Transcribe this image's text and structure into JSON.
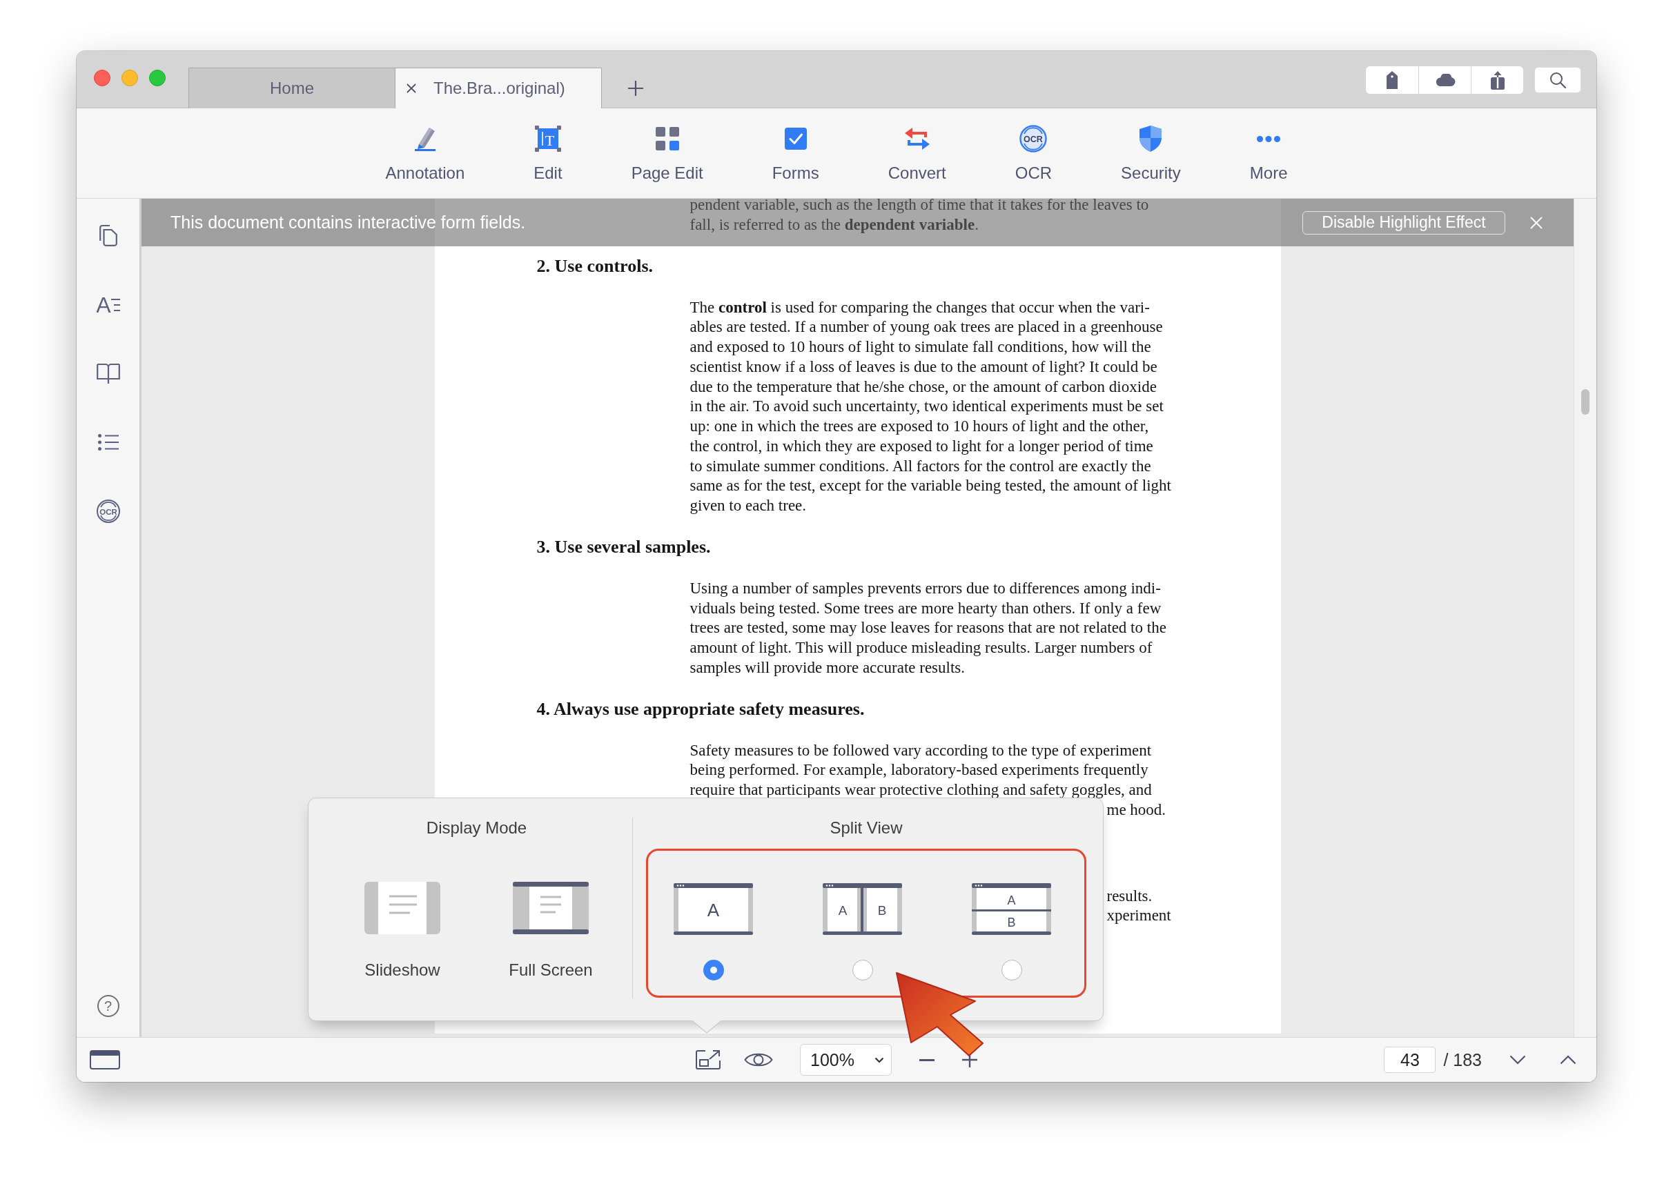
{
  "tabs": [
    {
      "label": "Home",
      "selected": false
    },
    {
      "label": "The.Bra...original)",
      "selected": true
    }
  ],
  "toolbar": {
    "items": [
      {
        "label": "Annotation",
        "kind": "pen"
      },
      {
        "label": "Edit",
        "kind": "text-box",
        "glyph": "T"
      },
      {
        "label": "Page Edit",
        "kind": "grid"
      },
      {
        "label": "Forms",
        "kind": "checkbox"
      },
      {
        "label": "Convert",
        "kind": "convert"
      },
      {
        "label": "OCR",
        "kind": "ocr",
        "glyph": "OCR"
      },
      {
        "label": "Security",
        "kind": "shield"
      },
      {
        "label": "More",
        "kind": "more"
      }
    ]
  },
  "sidebar": {
    "items": [
      {
        "kind": "pages"
      },
      {
        "kind": "font",
        "glyph": "A"
      },
      {
        "kind": "book"
      },
      {
        "kind": "list"
      },
      {
        "kind": "ocr",
        "glyph": "OCR"
      }
    ],
    "help_glyph": "?"
  },
  "banner": {
    "message": "This document contains interactive form fields.",
    "button": "Disable Highlight Effect"
  },
  "document": {
    "blocks": [
      {
        "kind": "paragraph",
        "lines": [
          "pendent variable, such as the length of time that it takes for the leaves to",
          "fall, is referred to as the **dependent variable**."
        ]
      },
      {
        "kind": "heading",
        "text": "2. Use controls."
      },
      {
        "kind": "paragraph",
        "lines": [
          "The **control** is used for comparing the changes that occur when the vari-",
          "ables are tested. If a number of young oak trees are placed in a greenhouse",
          "and exposed to 10 hours of light to simulate fall conditions, how will the",
          "scientist know if a loss of leaves is due to the amount of light? It could be",
          "due to the temperature that he/she chose, or the amount of carbon dioxide",
          "in the air. To avoid such uncertainty, two identical experiments must be set",
          "up: one in which the trees are exposed to 10 hours of light and the other,",
          "the control, in which they are exposed to light for a longer period of time",
          "to simulate summer conditions. All factors for the control are exactly the",
          "same as for the test, except for the variable being tested, the amount of light",
          "given to each tree."
        ]
      },
      {
        "kind": "heading",
        "text": "3. Use several samples."
      },
      {
        "kind": "paragraph",
        "lines": [
          "Using a number of samples prevents errors due to differences among indi-",
          "viduals being tested. Some trees are more hearty than others. If only a few",
          "trees are tested, some may lose leaves for reasons that are not related to the",
          "amount of light. This will produce misleading results. Larger numbers of",
          "samples will provide more accurate results."
        ]
      },
      {
        "kind": "heading",
        "text": "4. Always use appropriate safety measures."
      },
      {
        "kind": "paragraph",
        "lines": [
          "Safety measures to be followed vary according to the type of experiment",
          "being performed. For example, laboratory-based experiments frequently",
          "require that participants wear protective clothing and safety goggles, and"
        ]
      },
      {
        "kind": "partial",
        "lines": [
          "me hood."
        ]
      },
      {
        "kind": "partial",
        "lines": [
          "results.",
          "xperiment"
        ]
      }
    ]
  },
  "view_popup": {
    "display_mode": {
      "title": "Display Mode",
      "options": [
        {
          "label": "Slideshow",
          "kind": "slideshow"
        },
        {
          "label": "Full Screen",
          "kind": "full-screen"
        }
      ]
    },
    "split_view": {
      "title": "Split View",
      "options": [
        {
          "kind": "single",
          "panes": [
            "A"
          ],
          "selected": true
        },
        {
          "kind": "columns",
          "panes": [
            "A",
            "B"
          ],
          "selected": false
        },
        {
          "kind": "rows",
          "panes": [
            "A",
            "B"
          ],
          "selected": false
        }
      ]
    }
  },
  "status_bar": {
    "zoom": "100%",
    "page": "43",
    "page_total": "/ 183"
  }
}
